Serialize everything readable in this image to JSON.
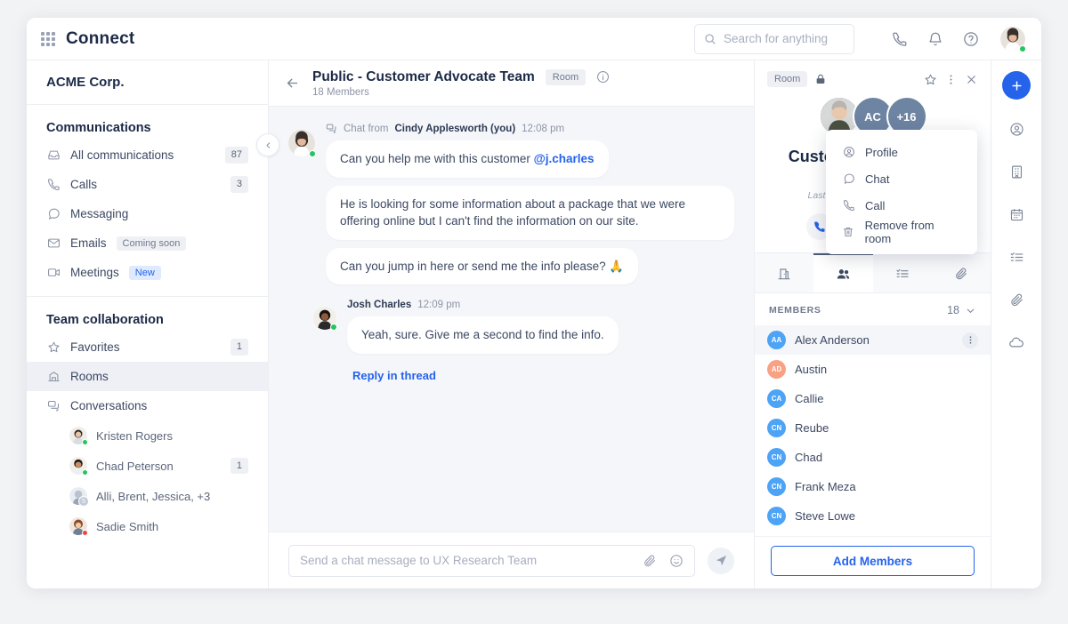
{
  "app": {
    "brand": "Connect",
    "grid_icon": "grid-apps-icon"
  },
  "search": {
    "placeholder": "Search for anything",
    "icon": "search-icon"
  },
  "header_icons": [
    {
      "name": "phone-icon"
    },
    {
      "name": "bell-icon"
    },
    {
      "name": "help-circle-icon"
    }
  ],
  "user_avatar": {
    "name": "user-avatar",
    "status": "online"
  },
  "sidebar": {
    "org": "ACME Corp.",
    "collapse_icon": "chevron-left-icon",
    "sections": [
      {
        "title": "Communications",
        "items": [
          {
            "label": "All communications",
            "icon": "inbox-icon",
            "badge": "87"
          },
          {
            "label": "Calls",
            "icon": "phone-icon",
            "badge": "3"
          },
          {
            "label": "Messaging",
            "icon": "chat-bubble-icon",
            "badge": ""
          },
          {
            "label": "Emails",
            "icon": "envelope-icon",
            "tag": "Coming soon",
            "tag_type": "soon"
          },
          {
            "label": "Meetings",
            "icon": "video-camera-icon",
            "tag": "New",
            "tag_type": "new"
          }
        ]
      },
      {
        "title": "Team collaboration",
        "items": [
          {
            "label": "Favorites",
            "icon": "star-icon",
            "badge": "1"
          },
          {
            "label": "Rooms",
            "icon": "rooms-icon",
            "badge": "",
            "active": true
          },
          {
            "label": "Conversations",
            "icon": "conversations-icon",
            "badge": ""
          }
        ]
      }
    ],
    "conversations": [
      {
        "name": "Kristen Rogers",
        "badge": "",
        "status": "online"
      },
      {
        "name": "Chad Peterson",
        "badge": "1",
        "status": "online"
      },
      {
        "name": "Alli, Brent, Jessica, +3",
        "badge": "",
        "count": "5"
      },
      {
        "name": "Sadie Smith",
        "badge": "",
        "status": "busy"
      }
    ]
  },
  "chat": {
    "back_icon": "arrow-left-icon",
    "title": "Public - Customer Advocate Team",
    "tag": "Room",
    "subtitle": "18 Members",
    "info_icon": "info-circle-icon",
    "groups": [
      {
        "prefix": "Chat from",
        "author": "Cindy Applesworth (you)",
        "time": "12:08 pm",
        "icon": "conversations-icon",
        "avatar_status": "online",
        "messages": [
          {
            "text": "Can you help me with this customer ",
            "mention": "@j.charles"
          },
          {
            "text": "He is looking for some information about a package that we were offering online but I can't find the information on our site.",
            "mention": ""
          },
          {
            "text": "Can you jump in here or send me the info please? 🙏",
            "mention": ""
          }
        ]
      },
      {
        "prefix": "",
        "author": "Josh Charles",
        "time": "12:09 pm",
        "icon": "",
        "avatar_status": "online",
        "messages": [
          {
            "text": "Yeah, sure. Give me a second to find the info.",
            "mention": ""
          }
        ]
      }
    ],
    "reply_link": "Reply in thread",
    "composer": {
      "placeholder": "Send a chat message to UX Research Team",
      "attach_icon": "paperclip-icon",
      "emoji_icon": "smiley-icon",
      "send_icon": "send-plane-icon"
    }
  },
  "detail": {
    "tag": "Room",
    "lock_icon": "lock-icon",
    "star_icon": "star-icon",
    "kebab_icon": "more-vertical-icon",
    "close_icon": "close-icon",
    "avatars": [
      {
        "type": "photo",
        "label": ""
      },
      {
        "type": "initials",
        "label": "AC"
      },
      {
        "type": "initials",
        "label": "+16"
      }
    ],
    "name": "Customer Advocate ...",
    "members": "18 Members",
    "last_message": "Last message 3 min ago by me",
    "actions": [
      {
        "name": "call-action",
        "icon": "phone-icon"
      },
      {
        "name": "email-action",
        "icon": "envelope-icon"
      },
      {
        "name": "video-action",
        "icon": "video-camera-icon"
      },
      {
        "name": "chat-action",
        "icon": "chat-bubble-icon"
      }
    ],
    "tabs": [
      {
        "name": "tab-room",
        "icon": "door-icon",
        "active": false
      },
      {
        "name": "tab-members",
        "icon": "people-icon",
        "active": true
      },
      {
        "name": "tab-tasks",
        "icon": "task-list-icon",
        "active": false
      },
      {
        "name": "tab-files",
        "icon": "paperclip-icon",
        "active": false
      }
    ],
    "members_header": "MEMBERS",
    "members_count": "18",
    "chevron_icon": "chevron-down-icon",
    "member_list": [
      {
        "initials": "AA",
        "name": "Alex Anderson",
        "color": "#4da3f5",
        "selected": true
      },
      {
        "initials": "AD",
        "name": "Austin",
        "color": "#f9a183",
        "selected": false
      },
      {
        "initials": "CA",
        "name": "Callie",
        "color": "#4da3f5",
        "selected": false
      },
      {
        "initials": "CN",
        "name": "Reube",
        "color": "#4da3f5",
        "selected": false
      },
      {
        "initials": "CN",
        "name": "Chad",
        "color": "#4da3f5",
        "selected": false
      },
      {
        "initials": "CN",
        "name": "Frank Meza",
        "color": "#4da3f5",
        "selected": false
      },
      {
        "initials": "CN",
        "name": "Steve Lowe",
        "color": "#4da3f5",
        "selected": false
      }
    ],
    "context_menu": [
      {
        "label": "Profile",
        "icon": "profile-icon"
      },
      {
        "label": "Chat",
        "icon": "chat-bubble-icon"
      },
      {
        "label": "Call",
        "icon": "phone-icon"
      },
      {
        "label": "Remove from room",
        "icon": "trash-icon"
      }
    ],
    "add_button": "Add Members"
  },
  "rail": [
    {
      "name": "rail-add-button",
      "icon": "plus-icon",
      "primary": true
    },
    {
      "name": "rail-contacts",
      "icon": "contact-circle-icon"
    },
    {
      "name": "rail-company",
      "icon": "building-icon"
    },
    {
      "name": "rail-calendar",
      "icon": "calendar-icon"
    },
    {
      "name": "rail-tasks",
      "icon": "task-list-icon"
    },
    {
      "name": "rail-files",
      "icon": "paperclip-icon"
    },
    {
      "name": "rail-cloud",
      "icon": "cloud-icon"
    }
  ],
  "colors": {
    "accent": "#2563eb",
    "chat_bg": "#f5f6f9",
    "avatar_group": "#6e84a3",
    "online": "#22c55e",
    "busy": "#ef4444"
  }
}
